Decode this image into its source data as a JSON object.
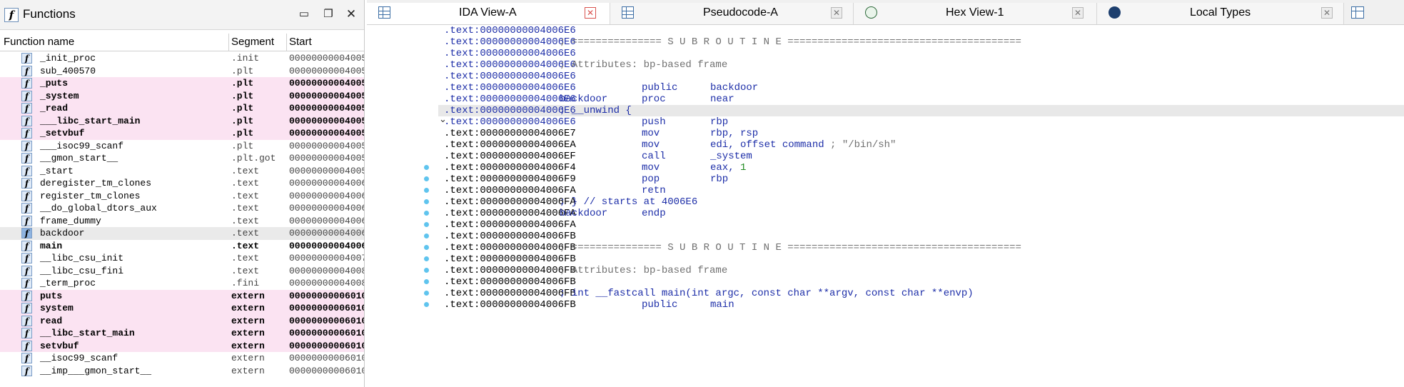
{
  "functions_window": {
    "title": "Functions",
    "columns": {
      "name": "Function name",
      "segment": "Segment",
      "start": "Start"
    },
    "icon_glyph": "f",
    "rows": [
      {
        "name": "_init_proc",
        "segment": ".init",
        "start": "00000000004005",
        "style": "normal"
      },
      {
        "name": "sub_400570",
        "segment": ".plt",
        "start": "00000000004005",
        "style": "normal"
      },
      {
        "name": "_puts",
        "segment": ".plt",
        "start": "00000000004005",
        "style": "highlight"
      },
      {
        "name": "_system",
        "segment": ".plt",
        "start": "00000000004005",
        "style": "highlight"
      },
      {
        "name": "_read",
        "segment": ".plt",
        "start": "00000000004005",
        "style": "highlight"
      },
      {
        "name": "___libc_start_main",
        "segment": ".plt",
        "start": "00000000004005",
        "style": "highlight"
      },
      {
        "name": "_setvbuf",
        "segment": ".plt",
        "start": "00000000004005",
        "style": "highlight"
      },
      {
        "name": "___isoc99_scanf",
        "segment": ".plt",
        "start": "00000000004005",
        "style": "normal"
      },
      {
        "name": "__gmon_start__",
        "segment": ".plt.got",
        "start": "00000000004005",
        "style": "normal"
      },
      {
        "name": "_start",
        "segment": ".text",
        "start": "00000000004005",
        "style": "normal"
      },
      {
        "name": "deregister_tm_clones",
        "segment": ".text",
        "start": "00000000004006",
        "style": "normal"
      },
      {
        "name": "register_tm_clones",
        "segment": ".text",
        "start": "00000000004006",
        "style": "normal"
      },
      {
        "name": "__do_global_dtors_aux",
        "segment": ".text",
        "start": "00000000004006",
        "style": "normal"
      },
      {
        "name": "frame_dummy",
        "segment": ".text",
        "start": "00000000004006",
        "style": "normal"
      },
      {
        "name": "backdoor",
        "segment": ".text",
        "start": "00000000004006",
        "style": "selected"
      },
      {
        "name": "main",
        "segment": ".text",
        "start": "00000000004006",
        "style": "bold"
      },
      {
        "name": "__libc_csu_init",
        "segment": ".text",
        "start": "00000000004007",
        "style": "normal"
      },
      {
        "name": "__libc_csu_fini",
        "segment": ".text",
        "start": "00000000004008",
        "style": "normal"
      },
      {
        "name": "_term_proc",
        "segment": ".fini",
        "start": "00000000004008",
        "style": "normal"
      },
      {
        "name": "puts",
        "segment": "extern",
        "start": "00000000006010",
        "style": "highlight"
      },
      {
        "name": "system",
        "segment": "extern",
        "start": "00000000006010",
        "style": "highlight"
      },
      {
        "name": "read",
        "segment": "extern",
        "start": "00000000006010",
        "style": "highlight"
      },
      {
        "name": "__libc_start_main",
        "segment": "extern",
        "start": "00000000006010",
        "style": "highlight"
      },
      {
        "name": "setvbuf",
        "segment": "extern",
        "start": "00000000006010",
        "style": "highlight"
      },
      {
        "name": "__isoc99_scanf",
        "segment": "extern",
        "start": "00000000006010",
        "style": "normal"
      },
      {
        "name": "__imp___gmon_start__",
        "segment": "extern",
        "start": "00000000006010",
        "style": "normal"
      }
    ]
  },
  "tabs": [
    {
      "label": "IDA View-A",
      "icon": "grid-icon",
      "active": true
    },
    {
      "label": "Pseudocode-A",
      "icon": "grid-icon",
      "active": false
    },
    {
      "label": "Hex View-1",
      "icon": "hex-icon",
      "active": false
    },
    {
      "label": "Local Types",
      "icon": "info-icon",
      "active": false
    }
  ],
  "colors": {
    "highlight_row": "#fbe3f2",
    "code_blue": "#1d2ea8",
    "comment_gray": "#707070",
    "number_green": "#1f8a1f",
    "gutter_dot": "#5fc4ee"
  },
  "disassembly": [
    {
      "addr": ".text:00000000004006E6",
      "blue": true,
      "comment": ""
    },
    {
      "addr": ".text:00000000004006E6",
      "blue": true,
      "comment": "; =============== S U B R O U T I N E ======================================="
    },
    {
      "addr": ".text:00000000004006E6",
      "blue": true,
      "comment": ""
    },
    {
      "addr": ".text:00000000004006E6",
      "blue": true,
      "comment": "; Attributes: bp-based frame"
    },
    {
      "addr": ".text:00000000004006E6",
      "blue": true,
      "comment": ""
    },
    {
      "addr": ".text:00000000004006E6",
      "blue": true,
      "mnemonic": "public",
      "operands": "backdoor"
    },
    {
      "addr": ".text:00000000004006E6",
      "blue": true,
      "label": "backdoor",
      "mnemonic": "proc",
      "operands": "near"
    },
    {
      "addr": ".text:00000000004006E6",
      "blue": true,
      "current": true,
      "code_comment": "; __unwind {"
    },
    {
      "addr": ".text:00000000004006E6",
      "blue": true,
      "chevron": true,
      "mnemonic": "push",
      "operands": "rbp"
    },
    {
      "addr": ".text:00000000004006E7",
      "mnemonic": "mov",
      "operands": "rbp, rsp"
    },
    {
      "addr": ".text:00000000004006EA",
      "mnemonic": "mov",
      "operands": "edi, offset command",
      "tail": " ; \"/bin/sh\""
    },
    {
      "addr": ".text:00000000004006EF",
      "mnemonic": "call",
      "operands": "_system"
    },
    {
      "addr": ".text:00000000004006F4",
      "mnemonic": "mov",
      "operands": "eax, ",
      "number": "1",
      "dot": true
    },
    {
      "addr": ".text:00000000004006F9",
      "mnemonic": "pop",
      "operands": "rbp",
      "dot": true
    },
    {
      "addr": ".text:00000000004006FA",
      "mnemonic": "retn",
      "dot": true
    },
    {
      "addr": ".text:00000000004006FA",
      "code_comment": "; } // starts at 4006E6",
      "dot": true
    },
    {
      "addr": ".text:00000000004006FA",
      "label": "backdoor",
      "mnemonic": "endp",
      "dot": true
    },
    {
      "addr": ".text:00000000004006FA",
      "dot": true
    },
    {
      "addr": ".text:00000000004006FB",
      "dot": true
    },
    {
      "addr": ".text:00000000004006FB",
      "comment": "; =============== S U B R O U T I N E =======================================",
      "dot": true
    },
    {
      "addr": ".text:00000000004006FB",
      "dot": true
    },
    {
      "addr": ".text:00000000004006FB",
      "comment": "; Attributes: bp-based frame",
      "dot": true
    },
    {
      "addr": ".text:00000000004006FB",
      "dot": true
    },
    {
      "addr": ".text:00000000004006FB",
      "code_comment": "; int __fastcall main(int argc, const char **argv, const char **envp)",
      "dot": true
    },
    {
      "addr": ".text:00000000004006FB",
      "mnemonic": "public",
      "operands": "main",
      "dot": true
    }
  ]
}
